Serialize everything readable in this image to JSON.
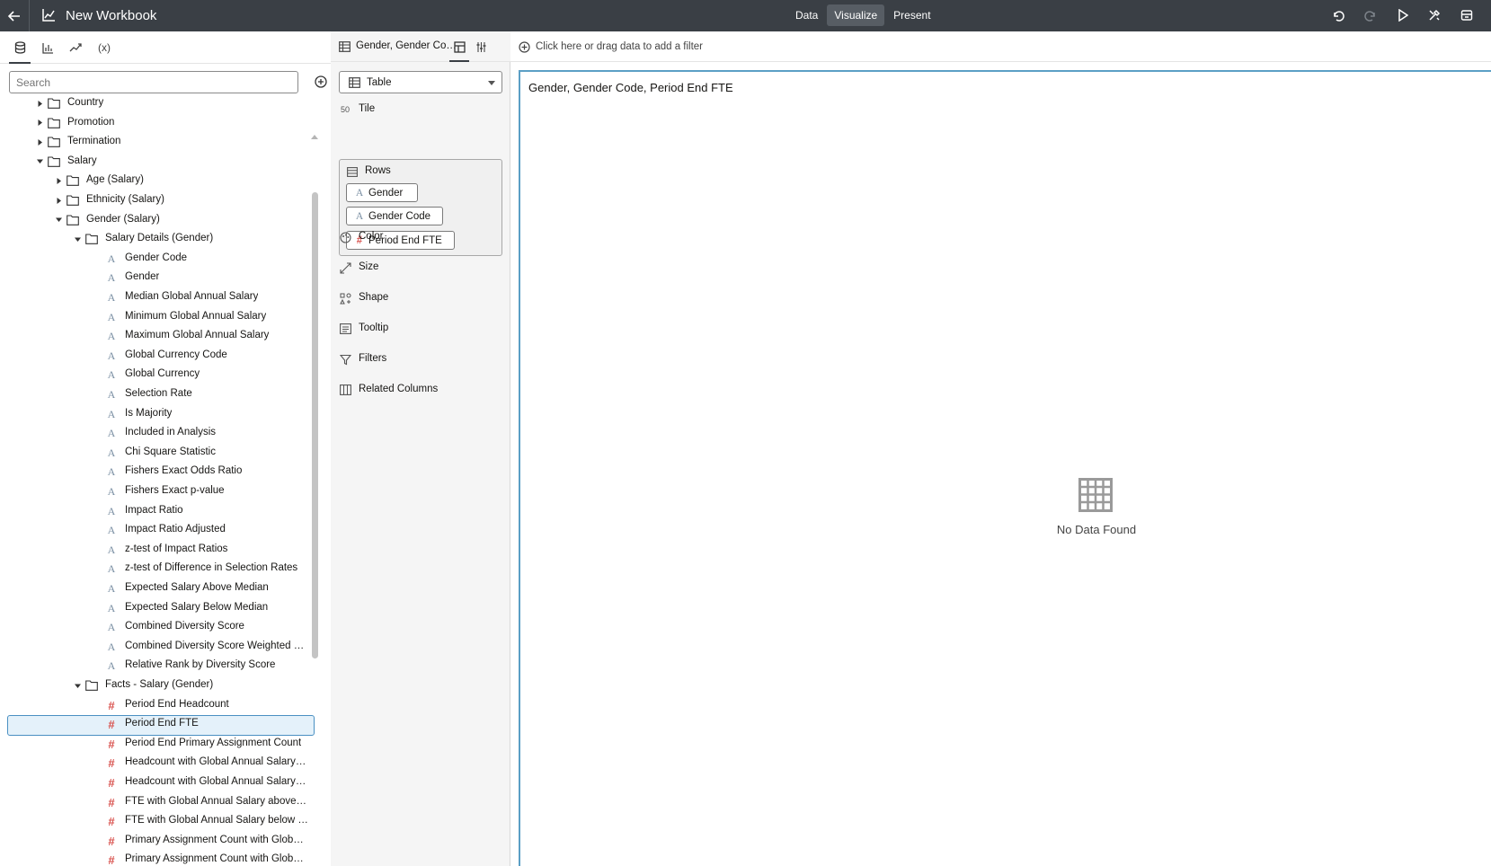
{
  "app": {
    "title": "New Workbook",
    "modes": [
      "Data",
      "Visualize",
      "Present"
    ],
    "active_mode": "Visualize"
  },
  "data_panel": {
    "search_placeholder": "Search",
    "tabs": [
      "data-icon",
      "visualizations-icon",
      "analytics-icon"
    ],
    "expressions_tab": "(x)",
    "tree": [
      {
        "label": "Country",
        "type": "folder",
        "level": 1,
        "expanded": false
      },
      {
        "label": "Promotion",
        "type": "folder",
        "level": 1,
        "expanded": false
      },
      {
        "label": "Termination",
        "type": "folder",
        "level": 1,
        "expanded": false
      },
      {
        "label": "Salary",
        "type": "folder",
        "level": 1,
        "expanded": true
      },
      {
        "label": "Age (Salary)",
        "type": "folder",
        "level": 2,
        "expanded": false
      },
      {
        "label": "Ethnicity (Salary)",
        "type": "folder",
        "level": 2,
        "expanded": false
      },
      {
        "label": "Gender (Salary)",
        "type": "folder",
        "level": 2,
        "expanded": true
      },
      {
        "label": "Salary Details (Gender)",
        "type": "folder",
        "level": 3,
        "expanded": true
      },
      {
        "label": "Gender Code",
        "type": "attribute",
        "level": 4
      },
      {
        "label": "Gender",
        "type": "attribute",
        "level": 4
      },
      {
        "label": "Median Global Annual Salary",
        "type": "attribute",
        "level": 4
      },
      {
        "label": "Minimum Global Annual Salary",
        "type": "attribute",
        "level": 4
      },
      {
        "label": "Maximum Global Annual Salary",
        "type": "attribute",
        "level": 4
      },
      {
        "label": "Global Currency Code",
        "type": "attribute",
        "level": 4
      },
      {
        "label": "Global Currency",
        "type": "attribute",
        "level": 4
      },
      {
        "label": "Selection Rate",
        "type": "attribute",
        "level": 4
      },
      {
        "label": "Is Majority",
        "type": "attribute",
        "level": 4
      },
      {
        "label": "Included in Analysis",
        "type": "attribute",
        "level": 4
      },
      {
        "label": "Chi Square Statistic",
        "type": "attribute",
        "level": 4
      },
      {
        "label": "Fishers Exact Odds Ratio",
        "type": "attribute",
        "level": 4
      },
      {
        "label": "Fishers Exact p-value",
        "type": "attribute",
        "level": 4
      },
      {
        "label": "Impact Ratio",
        "type": "attribute",
        "level": 4
      },
      {
        "label": "Impact Ratio Adjusted",
        "type": "attribute",
        "level": 4
      },
      {
        "label": "z-test of Impact Ratios",
        "type": "attribute",
        "level": 4
      },
      {
        "label": "z-test of Difference in Selection Rates",
        "type": "attribute",
        "level": 4
      },
      {
        "label": "Expected Salary Above Median",
        "type": "attribute",
        "level": 4
      },
      {
        "label": "Expected Salary Below Median",
        "type": "attribute",
        "level": 4
      },
      {
        "label": "Combined Diversity Score",
        "type": "attribute",
        "level": 4
      },
      {
        "label": "Combined Diversity Score Weighted by ...",
        "type": "attribute",
        "level": 4
      },
      {
        "label": "Relative Rank by Diversity Score",
        "type": "attribute",
        "level": 4
      },
      {
        "label": "Facts - Salary (Gender)",
        "type": "folder",
        "level": 3,
        "expanded": true
      },
      {
        "label": "Period End Headcount",
        "type": "measure",
        "level": 4
      },
      {
        "label": "Period End FTE",
        "type": "measure",
        "level": 4,
        "selected": true
      },
      {
        "label": "Period End Primary Assignment Count",
        "type": "measure",
        "level": 4
      },
      {
        "label": "Headcount with Global Annual Salary a...",
        "type": "measure",
        "level": 4
      },
      {
        "label": "Headcount with Global Annual Salary b...",
        "type": "measure",
        "level": 4
      },
      {
        "label": "FTE with Global Annual Salary above M...",
        "type": "measure",
        "level": 4
      },
      {
        "label": "FTE with Global Annual Salary below M...",
        "type": "measure",
        "level": 4
      },
      {
        "label": "Primary Assignment Count with Global ...",
        "type": "measure",
        "level": 4
      },
      {
        "label": "Primary Assignment Count with Global ...",
        "type": "measure",
        "level": 4
      }
    ]
  },
  "grammar": {
    "viz_tab_title": "Gender, Gender Cod...",
    "viz_type": "Table",
    "tile_label": "Tile",
    "rows_label": "Rows",
    "rows": [
      {
        "label": "Gender",
        "type": "attribute"
      },
      {
        "label": "Gender Code",
        "type": "attribute"
      },
      {
        "label": "Period End FTE",
        "type": "measure"
      }
    ],
    "sections": [
      "Color",
      "Size",
      "Shape",
      "Tooltip",
      "Filters",
      "Related Columns"
    ]
  },
  "canvas": {
    "filter_hint": "Click here or drag data to add a filter",
    "viz_title": "Gender, Gender Code, Period End FTE",
    "empty_message": "No Data Found"
  },
  "colors": {
    "topbar": "#3a3f45",
    "selection_fill": "#e4f1fa",
    "selection_border": "#4a90c2",
    "measure_icon": "#d9534f",
    "attribute_icon": "#7a8fa3",
    "viz_border": "#5b9fc5"
  }
}
